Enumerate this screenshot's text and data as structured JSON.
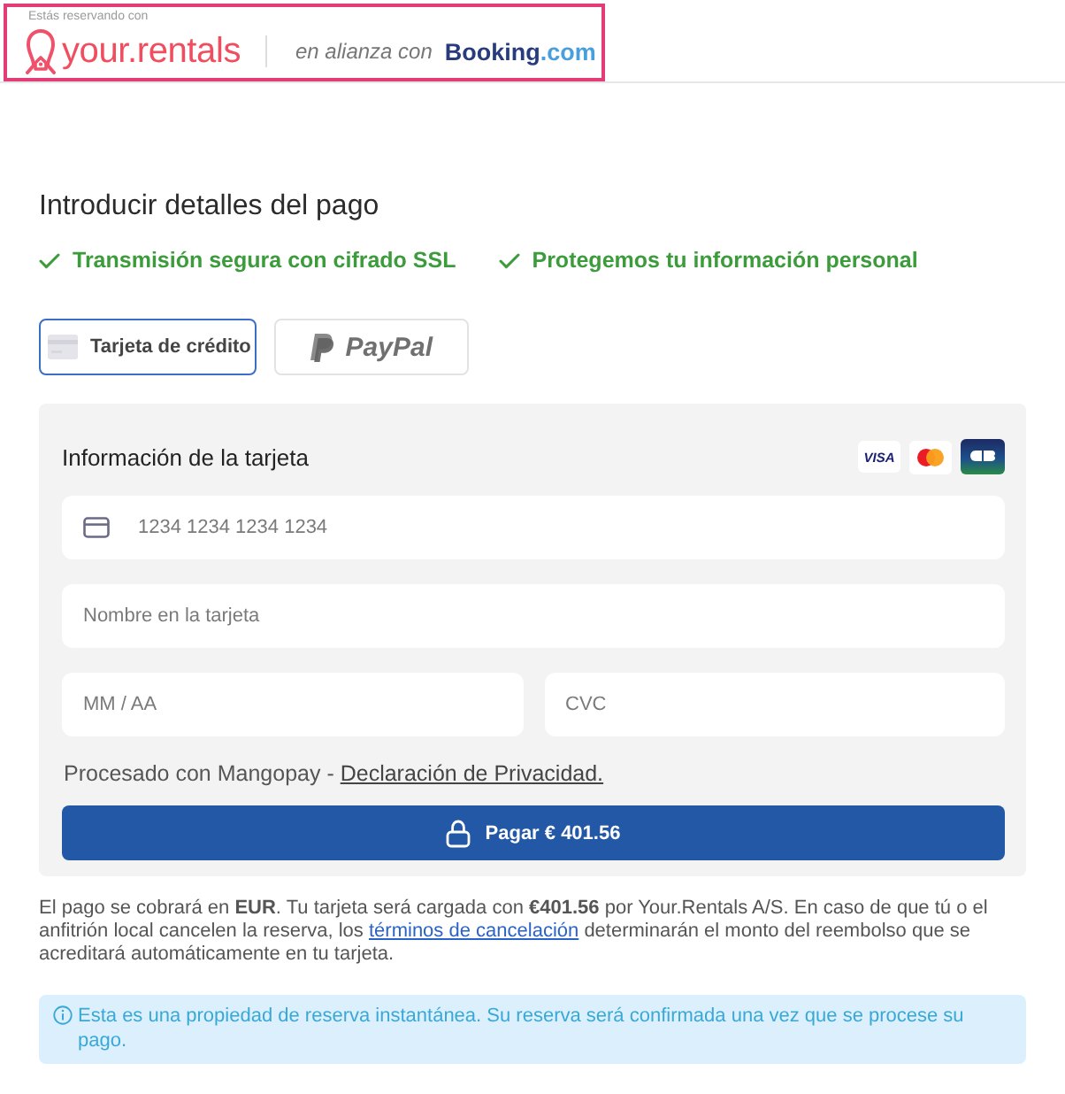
{
  "header": {
    "caption": "Estás reservando con",
    "brand": "your.rentals",
    "partner_text": "en alianza con",
    "partner_logo": {
      "name": "Booking",
      "domain": ".com"
    }
  },
  "title": "Introducir detalles del pago",
  "assurances": [
    "Transmisión segura con cifrado SSL",
    "Protegemos tu información personal"
  ],
  "payment_methods": [
    {
      "kind": "card",
      "label": "Tarjeta de crédito",
      "selected": true
    },
    {
      "kind": "paypal",
      "label": "PayPal",
      "selected": false
    }
  ],
  "card_form": {
    "heading": "Información de la tarjeta",
    "card_brands": [
      {
        "kind": "visa",
        "label": "VISA"
      },
      {
        "kind": "mastercard"
      },
      {
        "kind": "cb"
      }
    ],
    "field_rows": [
      [
        {
          "kind": "card-number",
          "placeholder": "1234 1234 1234 1234"
        }
      ],
      [
        {
          "kind": "cardholder",
          "placeholder": "Nombre en la tarjeta"
        }
      ],
      [
        {
          "kind": "expiry",
          "placeholder": "MM / AA"
        },
        {
          "kind": "cvc",
          "placeholder": "CVC"
        }
      ]
    ],
    "processor_note": {
      "text": "Procesado con Mangopay -",
      "link": "Declaración de Privacidad."
    },
    "pay_button": "Pagar € 401.56"
  },
  "notice": {
    "before": "El pago se cobrará en **EUR**. Tu tarjeta será cargada con **€401.56** por Your.Rentals A/S. En caso de que tú o el anfitrión local cancelen la reserva, los",
    "link": "términos de cancelación",
    "after": "determinarán el monto del reembolso que se acreditará automáticamente en tu tarjeta."
  },
  "info_banner": "Esta es una propiedad de reserva instantánea. Su reserva será confirmada una vez que se procese su pago."
}
